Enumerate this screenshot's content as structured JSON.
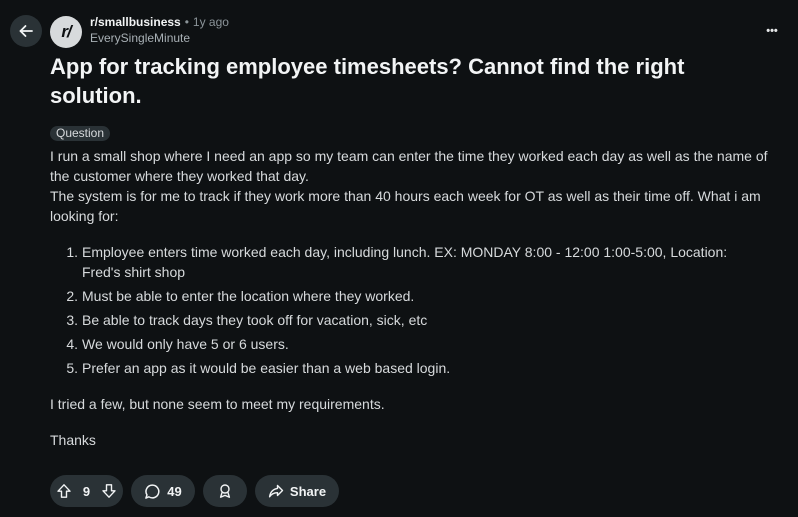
{
  "header": {
    "subreddit_avatar_text": "r/",
    "subreddit": "r/smallbusiness",
    "separator": "•",
    "time_ago": "1y ago",
    "author": "EverySingleMinute",
    "more_label": "•••"
  },
  "post": {
    "title": "App for tracking employee timesheets? Cannot find the right solution.",
    "flair": "Question",
    "paragraph1": "I run a small shop where I need an app so my team can enter the time they worked each day as well as the name of the customer where they worked that day.",
    "paragraph2": "The system is for me to track if they work more than 40 hours each week for OT as well as their time off. What i am looking for:",
    "list": [
      {
        "num": "1.",
        "text": "Employee enters time worked each day, including lunch. EX: MONDAY 8:00 - 12:00 1:00-5:00, Location: Fred's shirt shop"
      },
      {
        "num": "2.",
        "text": "Must be able to enter the location where they worked."
      },
      {
        "num": "3.",
        "text": "Be able to track days they took off for vacation, sick, etc"
      },
      {
        "num": "4.",
        "text": "We would only have 5 or 6 users."
      },
      {
        "num": "5.",
        "text": "Prefer an app as it would be easier than a web based login."
      }
    ],
    "paragraph3": "I tried a few, but none seem to meet my requirements.",
    "paragraph4": "Thanks"
  },
  "actions": {
    "vote_count": "9",
    "comment_count": "49",
    "share_label": "Share"
  },
  "colors": {
    "background": "#0e1113",
    "pill": "#2a3236",
    "text": "#d7dadc"
  },
  "icons": [
    "back-arrow-icon",
    "more-icon",
    "upvote-icon",
    "downvote-icon",
    "comment-icon",
    "award-icon",
    "share-icon"
  ]
}
